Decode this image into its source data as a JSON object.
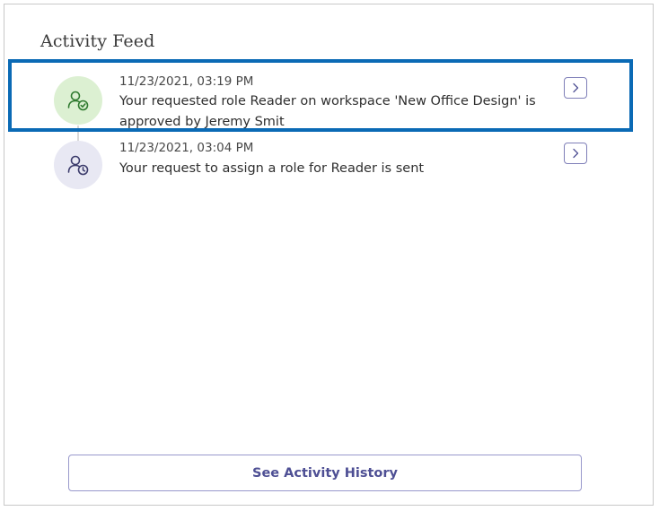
{
  "panel": {
    "title": "Activity Feed"
  },
  "activities": [
    {
      "timestamp": "11/23/2021, 03:19 PM",
      "message": "Your requested role Reader on workspace 'New Office Design' is approved by Jeremy Smit",
      "icon": "person-check-icon",
      "avatar_bg": "#dcf0d2",
      "icon_color": "#3a8a3a"
    },
    {
      "timestamp": "11/23/2021, 03:04 PM",
      "message": "Your request to assign a role for Reader is sent",
      "icon": "person-clock-icon",
      "avatar_bg": "#e8e8f3",
      "icon_color": "#4a4a78"
    }
  ],
  "footer": {
    "history_label": "See Activity History"
  },
  "colors": {
    "highlight": "#0a6ab5",
    "accent": "#4e4f94"
  }
}
